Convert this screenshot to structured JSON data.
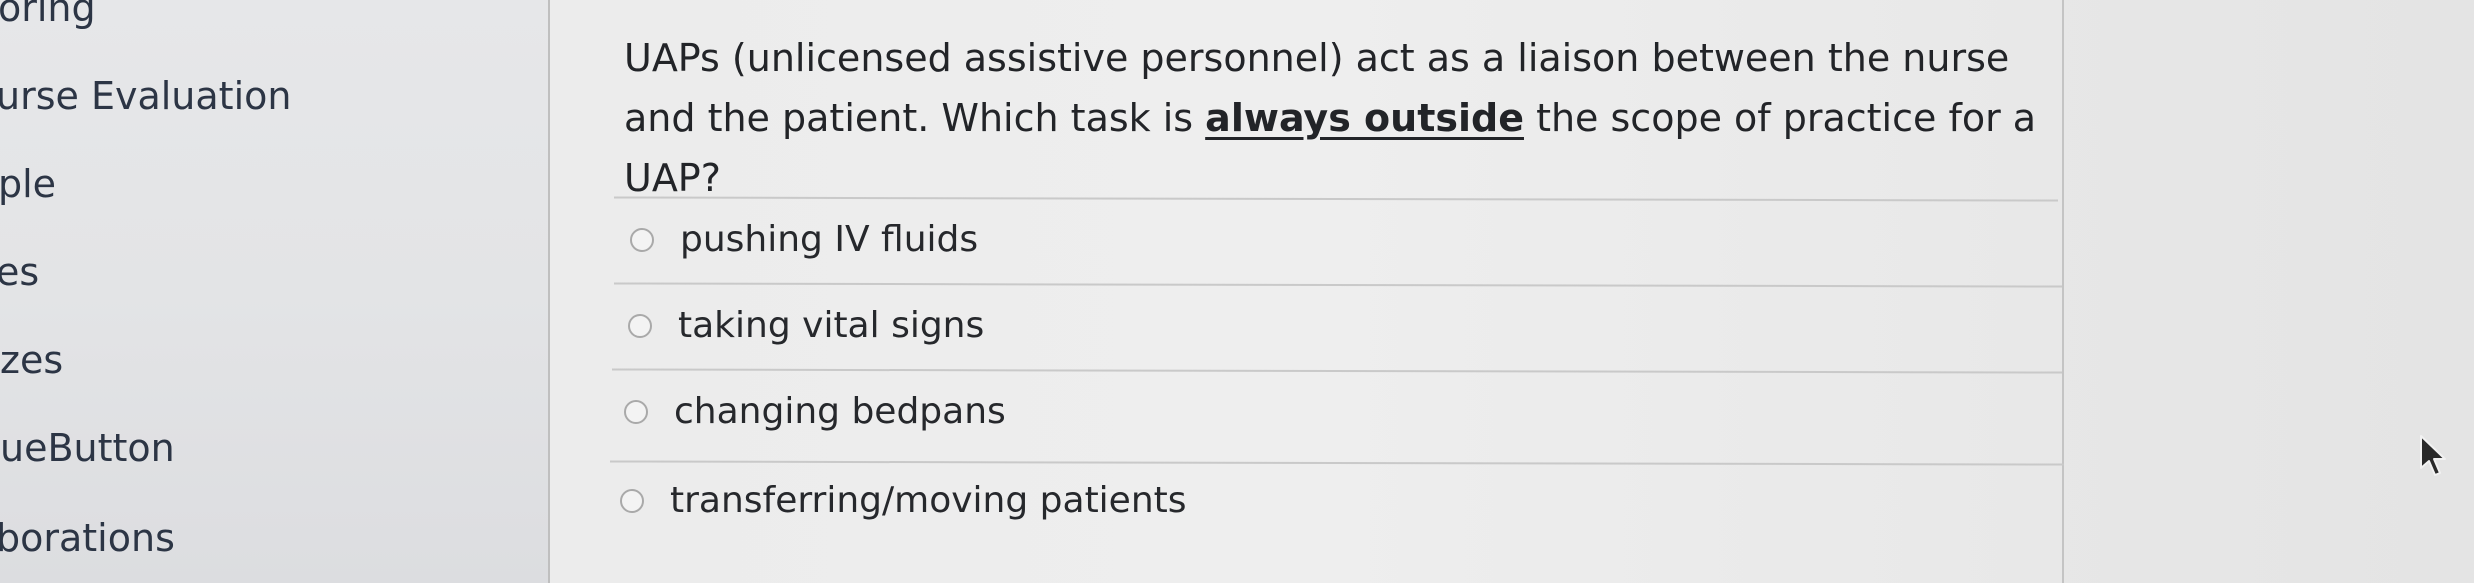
{
  "sidebar": {
    "items": [
      {
        "label": "oring"
      },
      {
        "label": "urse Evaluation"
      },
      {
        "label": "ple"
      },
      {
        "label": "es"
      },
      {
        "label": "zes"
      },
      {
        "label": "ueButton"
      },
      {
        "label": "borations"
      }
    ]
  },
  "question": {
    "text_before": "UAPs (unlicensed assistive personnel) act as a liaison between the nurse and the patient. Which task is ",
    "emphasis": "always outside",
    "text_after": " the scope of practice for a UAP?"
  },
  "options": [
    {
      "label": "pushing IV fluids"
    },
    {
      "label": "taking vital signs"
    },
    {
      "label": "changing bedpans"
    },
    {
      "label": "transferring/moving patients"
    }
  ],
  "colors": {
    "text": "#222428",
    "nav_text": "#2c3545",
    "divider": "#c9c9c9",
    "background": "#e9e9e9"
  }
}
